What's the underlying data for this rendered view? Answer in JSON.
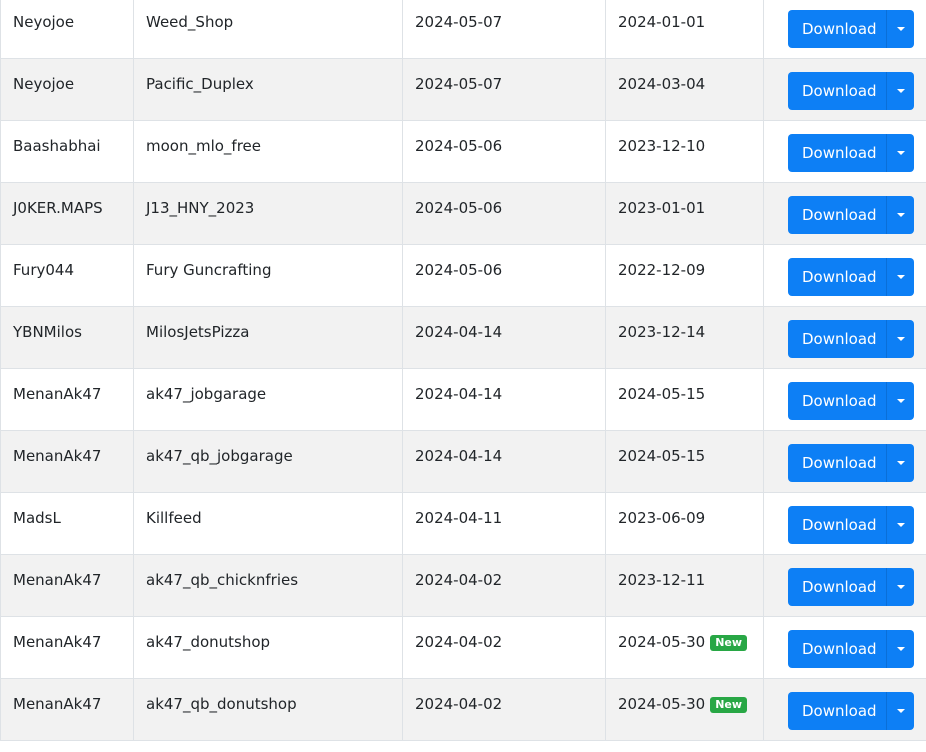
{
  "download_label": "Download",
  "new_badge": "New",
  "accent_color": "#0d7ff5",
  "badge_color": "#28a745",
  "rows": [
    {
      "author": "Neyojoe",
      "name": "Weed_Shop",
      "added": "2024-05-07",
      "updated": "2024-01-01",
      "is_new": false
    },
    {
      "author": "Neyojoe",
      "name": "Pacific_Duplex",
      "added": "2024-05-07",
      "updated": "2024-03-04",
      "is_new": false
    },
    {
      "author": "Baashabhai",
      "name": "moon_mlo_free",
      "added": "2024-05-06",
      "updated": "2023-12-10",
      "is_new": false
    },
    {
      "author": "J0KER.MAPS",
      "name": "J13_HNY_2023",
      "added": "2024-05-06",
      "updated": "2023-01-01",
      "is_new": false
    },
    {
      "author": "Fury044",
      "name": "Fury Guncrafting",
      "added": "2024-05-06",
      "updated": "2022-12-09",
      "is_new": false
    },
    {
      "author": "YBNMilos",
      "name": "MilosJetsPizza",
      "added": "2024-04-14",
      "updated": "2023-12-14",
      "is_new": false
    },
    {
      "author": "MenanAk47",
      "name": "ak47_jobgarage",
      "added": "2024-04-14",
      "updated": "2024-05-15",
      "is_new": false
    },
    {
      "author": "MenanAk47",
      "name": "ak47_qb_jobgarage",
      "added": "2024-04-14",
      "updated": "2024-05-15",
      "is_new": false
    },
    {
      "author": "MadsL",
      "name": "Killfeed",
      "added": "2024-04-11",
      "updated": "2023-06-09",
      "is_new": false
    },
    {
      "author": "MenanAk47",
      "name": "ak47_qb_chicknfries",
      "added": "2024-04-02",
      "updated": "2023-12-11",
      "is_new": false
    },
    {
      "author": "MenanAk47",
      "name": "ak47_donutshop",
      "added": "2024-04-02",
      "updated": "2024-05-30",
      "is_new": true
    },
    {
      "author": "MenanAk47",
      "name": "ak47_qb_donutshop",
      "added": "2024-04-02",
      "updated": "2024-05-30",
      "is_new": true
    }
  ]
}
